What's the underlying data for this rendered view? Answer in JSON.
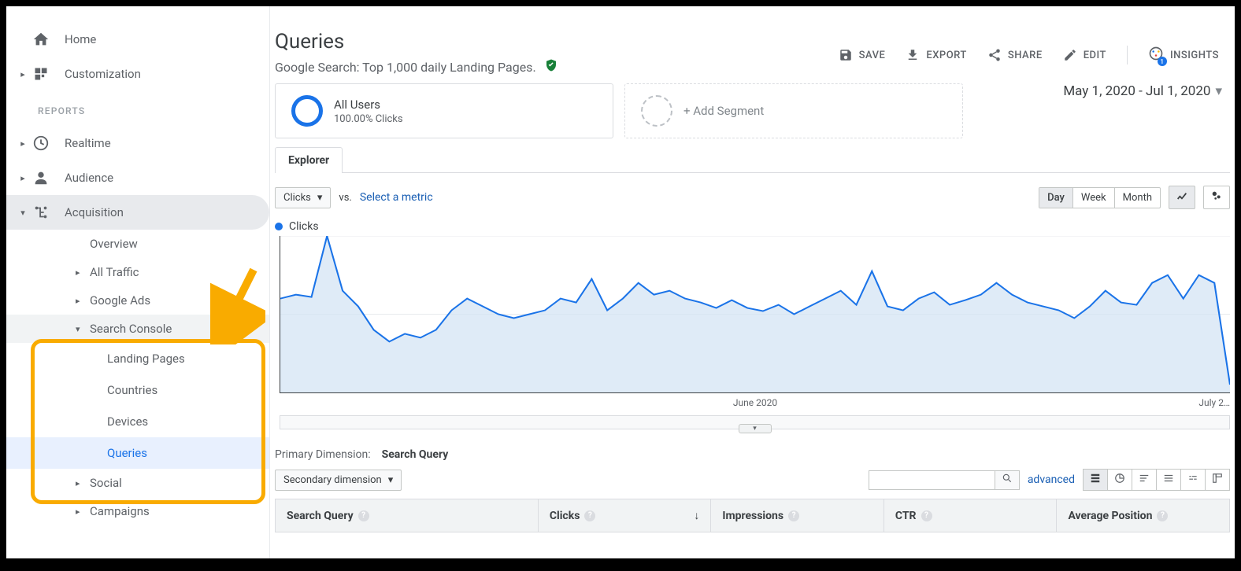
{
  "sidebar": {
    "home": "Home",
    "customization": "Customization",
    "reports_label": "REPORTS",
    "realtime": "Realtime",
    "audience": "Audience",
    "acquisition": "Acquisition",
    "acq_children": {
      "overview": "Overview",
      "all_traffic": "All Traffic",
      "google_ads": "Google Ads",
      "search_console": "Search Console",
      "sc_children": {
        "landing_pages": "Landing Pages",
        "countries": "Countries",
        "devices": "Devices",
        "queries": "Queries"
      },
      "social": "Social",
      "campaigns": "Campaigns"
    }
  },
  "header": {
    "title": "Queries",
    "subtitle": "Google Search: Top 1,000 daily Landing Pages.",
    "actions": {
      "save": "SAVE",
      "export": "EXPORT",
      "share": "SHARE",
      "edit": "EDIT",
      "insights": "INSIGHTS"
    }
  },
  "segments": {
    "all_users_title": "All Users",
    "all_users_sub": "100.00% Clicks",
    "add_segment": "+ Add Segment"
  },
  "date_range": "May 1, 2020 - Jul 1, 2020",
  "tabs": {
    "explorer": "Explorer"
  },
  "chart": {
    "metric_dd": "Clicks",
    "vs": "vs.",
    "select_metric": "Select a metric",
    "granularity": {
      "day": "Day",
      "week": "Week",
      "month": "Month"
    },
    "legend": "Clicks",
    "x_mid": "June 2020",
    "x_end": "July 2…"
  },
  "chart_data": {
    "type": "line",
    "title": "Clicks",
    "xlabel": "",
    "ylabel": "Clicks",
    "ylim": [
      0,
      200
    ],
    "y_ticks": [
      100,
      200
    ],
    "x_ticks": [
      "June 2020",
      "July 2…"
    ],
    "x": [
      0,
      1,
      2,
      3,
      4,
      5,
      6,
      7,
      8,
      9,
      10,
      11,
      12,
      13,
      14,
      15,
      16,
      17,
      18,
      19,
      20,
      21,
      22,
      23,
      24,
      25,
      26,
      27,
      28,
      29,
      30,
      31,
      32,
      33,
      34,
      35,
      36,
      37,
      38,
      39,
      40,
      41,
      42,
      43,
      44,
      45,
      46,
      47,
      48,
      49,
      50,
      51,
      52,
      53,
      54,
      55,
      56,
      57,
      58,
      59,
      60,
      61
    ],
    "values": [
      120,
      125,
      122,
      200,
      130,
      110,
      80,
      65,
      75,
      70,
      80,
      105,
      120,
      110,
      100,
      95,
      100,
      105,
      120,
      115,
      145,
      105,
      120,
      140,
      125,
      130,
      120,
      115,
      108,
      118,
      108,
      104,
      112,
      100,
      110,
      120,
      130,
      112,
      155,
      110,
      105,
      120,
      128,
      112,
      118,
      125,
      140,
      125,
      115,
      110,
      105,
      95,
      110,
      130,
      115,
      112,
      140,
      150,
      120,
      150,
      140,
      10
    ]
  },
  "dimension": {
    "label": "Primary Dimension:",
    "value": "Search Query",
    "secondary_btn": "Secondary dimension",
    "advanced": "advanced"
  },
  "table": {
    "cols": {
      "search_query": "Search Query",
      "clicks": "Clicks",
      "impressions": "Impressions",
      "ctr": "CTR",
      "avg_pos": "Average Position"
    }
  }
}
